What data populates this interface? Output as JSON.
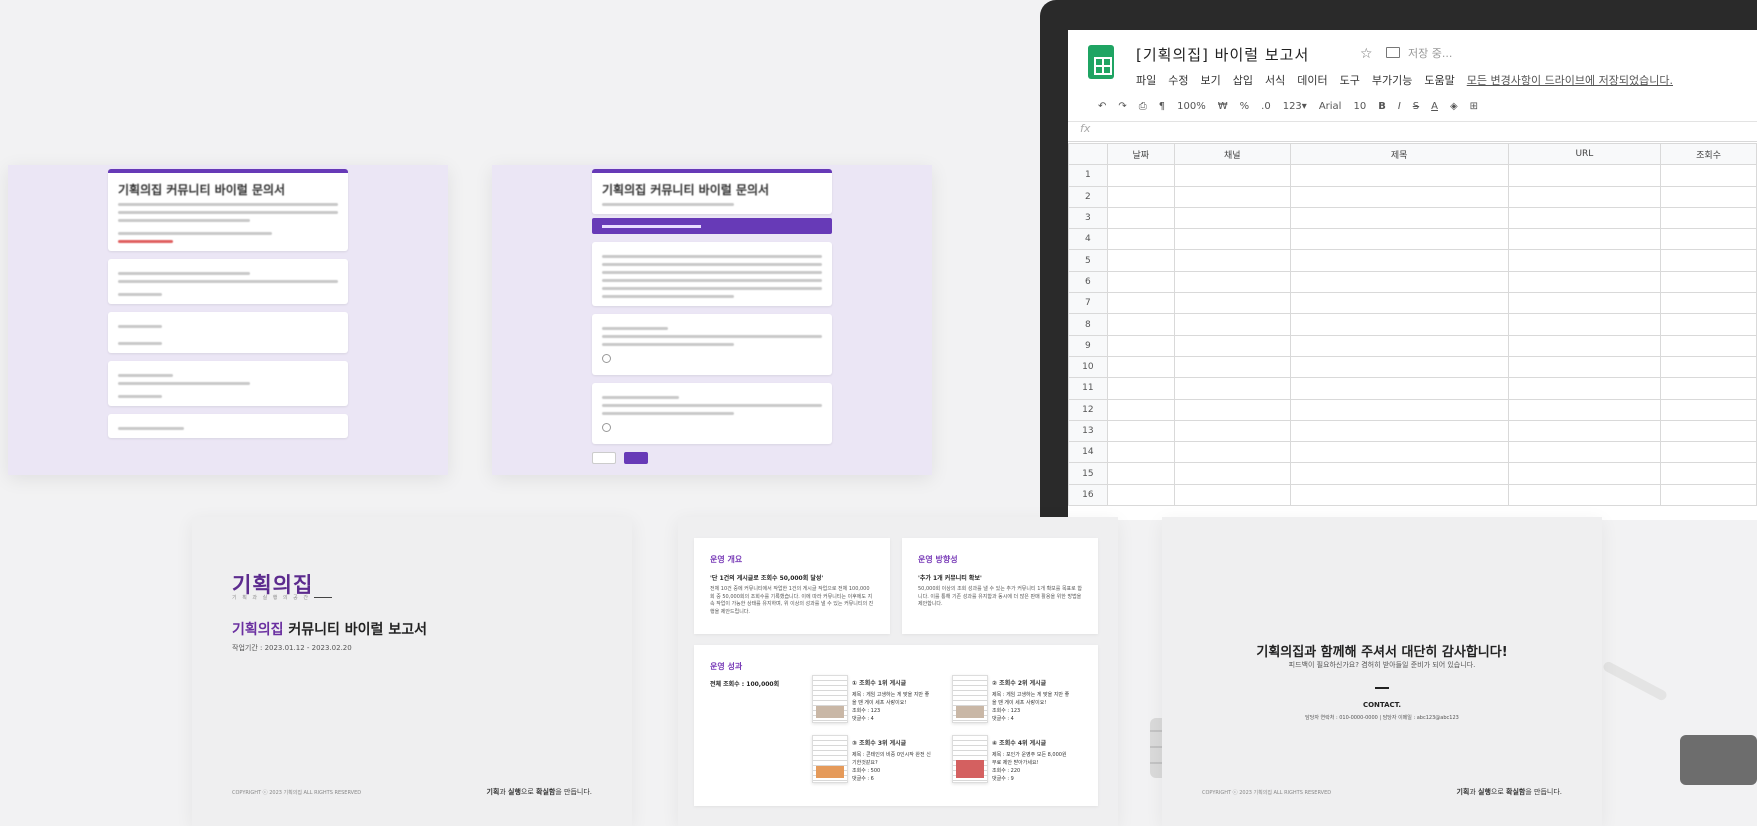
{
  "sheet": {
    "title": "[기획의집] 바이럴 보고서",
    "status": "저장 중...",
    "menu": [
      "파일",
      "수정",
      "보기",
      "삽입",
      "서식",
      "데이터",
      "도구",
      "부가기능",
      "도움말",
      "모든 변경사항이 드라이브에 저장되었습니다."
    ],
    "toolbar": {
      "zoom": "100%",
      "format": "123▾",
      "font": "Arial",
      "size": "10"
    },
    "fx": "fx",
    "columns": [
      "날짜",
      "채널",
      "제목",
      "URL",
      "조회수"
    ],
    "rows": [
      "1",
      "2",
      "3",
      "4",
      "5",
      "6",
      "7",
      "8",
      "9",
      "10",
      "11",
      "12",
      "13",
      "14",
      "15",
      "16"
    ]
  },
  "forms": [
    {
      "title": "기획의집 커뮤니티 바이럴 문의서"
    },
    {
      "title": "기획의집 커뮤니티 바이럴 문의서"
    }
  ],
  "slide_cover": {
    "brand": "기획의집",
    "brand_sub": "기 획 과  실 행 의  공 간",
    "title_highlight": "기획의집",
    "title_rest": " 커뮤니티 바이럴 보고서",
    "period": "작업기간 : 2023.01.12 - 2023.02.20",
    "copyright": "COPYRIGHT ⓒ 2023 기획의집 ALL RIGHTS RESERVED",
    "tagline": {
      "a": "기획",
      "b": "과 ",
      "c": "실행",
      "d": "으로 ",
      "e": "확실함",
      "f": "을 만듭니다."
    }
  },
  "slide_summary": {
    "overview": {
      "heading": "운영 개요",
      "question": "'단 1건의 게시글로 조회수 50,000회 달성'",
      "text": "전체 10건 중에 커뮤니티에서 작업한 1건의 게시글 작업으로 전체 100,000회 중 50,000회의 조회수를 기록했습니다. 이에 따라 커뮤니티는 이후에도 지속 작업이 가능한 상태를 유지하며, 위 이상의 성과를 낼 수 있는 커뮤니티의 진행을 제안드립니다."
    },
    "direction": {
      "heading": "운영 방향성",
      "question": "'추가 1개 커뮤니티 확보'",
      "text": "50,000회 이상의 조회 성과를 낼 수 있는 추가 커뮤니티 1개 확보를 목표로 합니다. 이를 통해 기존 성과를 유지함과 동시에 더 많은 판매 활용을 위한 방법을 제안합니다."
    },
    "results": {
      "heading": "운영 성과",
      "total": "전체 조회수 : 100,000회",
      "items": [
        {
          "title": "① 조회수 1위 게시글",
          "subject": "제목 : 게임 고생하는 게 맞을 지만 좋을 땐 게이 세프 사랑이요!",
          "views": "조회수 : 123",
          "comments": "댓글수 : 4"
        },
        {
          "title": "② 조회수 2위 게시글",
          "subject": "제목 : 게임 고생하는 게 맞을 지만 좋을 땐 게이 세프 사랑이요!",
          "views": "조회수 : 123",
          "comments": "댓글수 : 4"
        },
        {
          "title": "③ 조회수 3위 게시글",
          "subject": "제목 : 콘테인의 비중 0인시작 완전 신기한것같요?",
          "views": "조회수 : 500",
          "comments": "댓글수 : 6"
        },
        {
          "title": "④ 조회수 4위 게시글",
          "subject": "제목 : 포인가 운영주 모든 8,000원 무료 제안 받아가세요!",
          "views": "조회수 : 220",
          "comments": "댓글수 : 9"
        }
      ]
    }
  },
  "slide_thanks": {
    "title": "기획의집과 함께해 주셔서 대단히 감사합니다!",
    "subtitle": "피드백이 필요하신가요? 겸허히 받아들일 준비가 되어 있습니다.",
    "contact_label": "CONTACT.",
    "contact_line": "담당자 연락처 : 010-0000-0000  |  담당자 이메일 : abc123@abc123",
    "copyright": "COPYRIGHT ⓒ 2023 기획의집 ALL RIGHTS RESERVED",
    "tagline": {
      "a": "기획",
      "b": "과 ",
      "c": "실행",
      "d": "으로 ",
      "e": "확실함",
      "f": "을 만듭니다."
    }
  }
}
